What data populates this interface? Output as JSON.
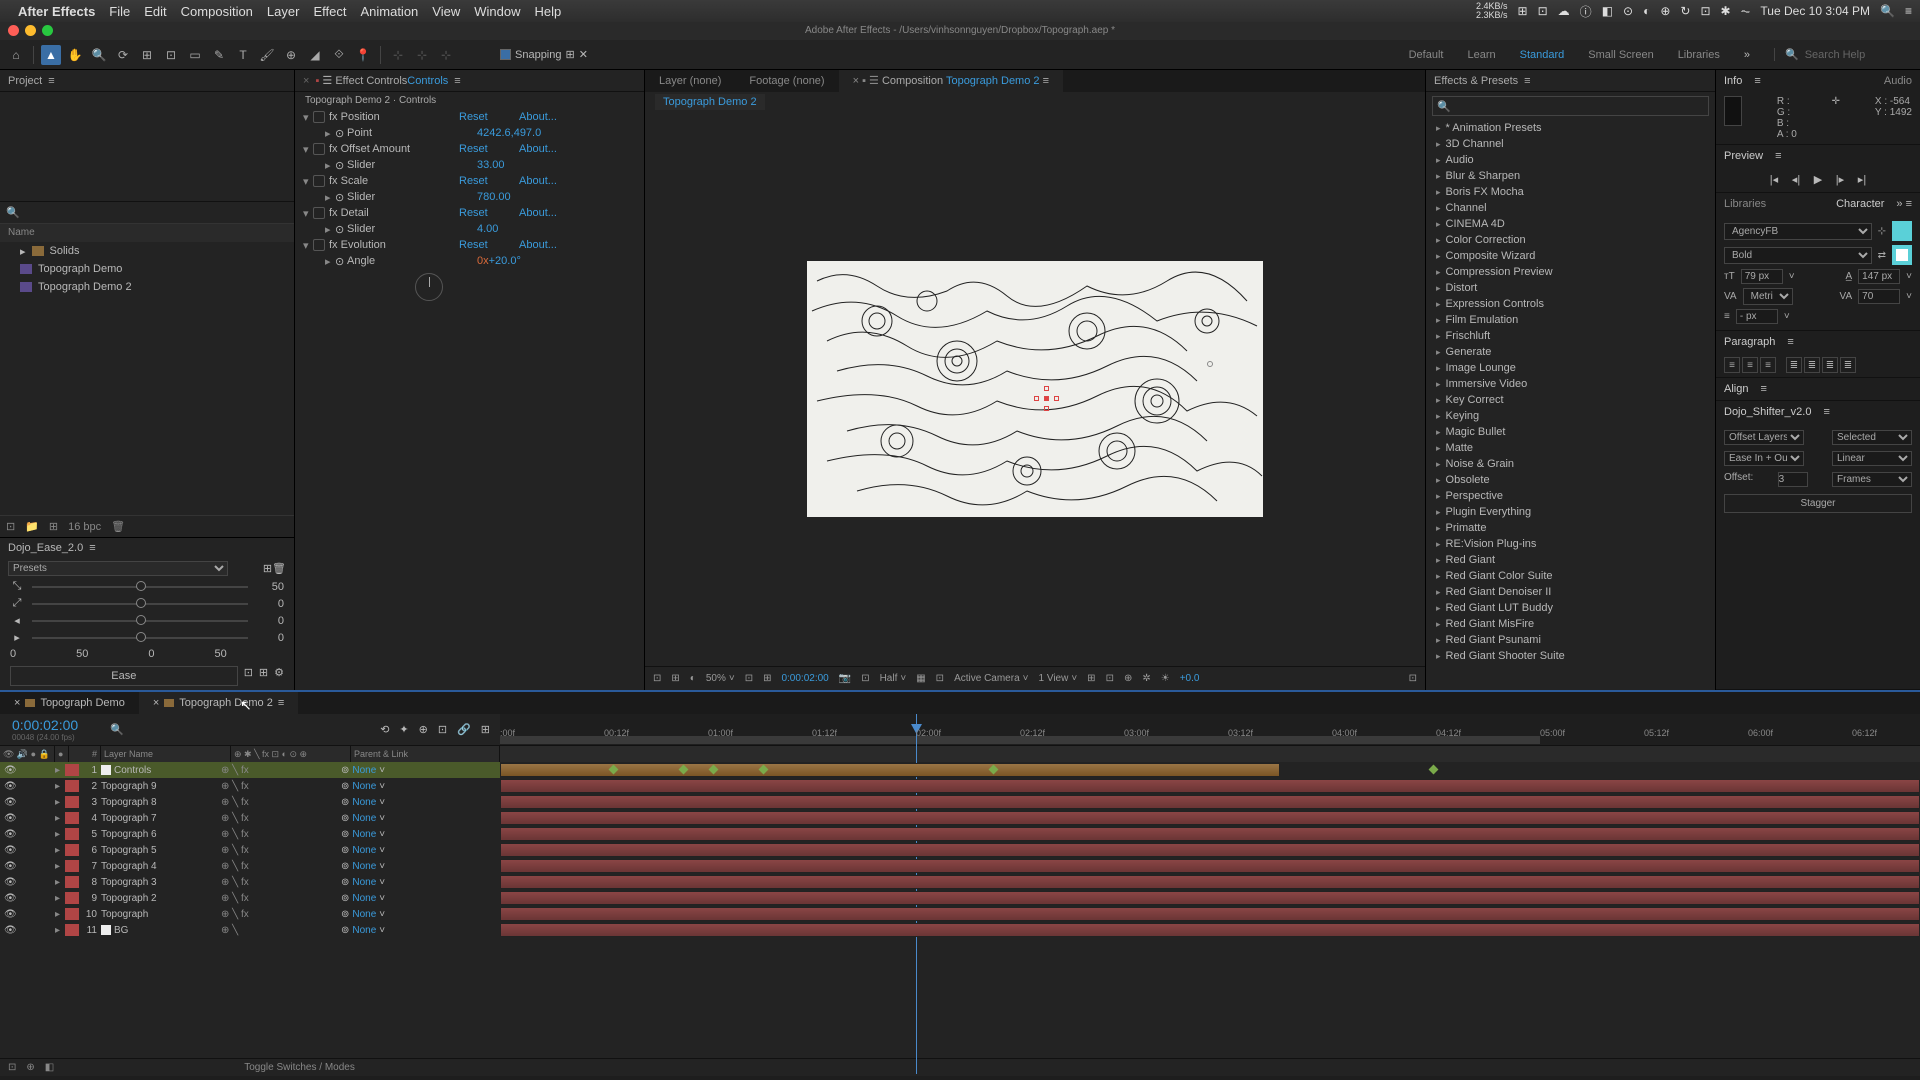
{
  "menubar": {
    "app": "After Effects",
    "items": [
      "File",
      "Edit",
      "Composition",
      "Layer",
      "Effect",
      "Animation",
      "View",
      "Window",
      "Help"
    ],
    "clock": "Tue Dec 10  3:04 PM",
    "net_up": "2.4KB/s",
    "net_dn": "2.3KB/s"
  },
  "doc_title": "Adobe After Effects - /Users/vinhsonnguyen/Dropbox/Topograph.aep *",
  "toolbar": {
    "snapping": "Snapping",
    "workspaces": [
      "Default",
      "Learn",
      "Standard",
      "Small Screen",
      "Libraries"
    ],
    "active_ws": "Standard",
    "search_ph": "Search Help"
  },
  "project": {
    "tab": "Project",
    "name_col": "Name",
    "items": [
      {
        "type": "folder",
        "name": "Solids"
      },
      {
        "type": "comp",
        "name": "Topograph Demo"
      },
      {
        "type": "comp",
        "name": "Topograph Demo 2"
      }
    ],
    "bpc": "16 bpc"
  },
  "effect_controls": {
    "tab_prefix": "Effect Controls ",
    "tab_hl": "Controls",
    "subtitle": "Topograph Demo 2 · Controls",
    "props": [
      {
        "name": "Position",
        "reset": "Reset",
        "about": "About...",
        "sub": {
          "name": "Point",
          "value": "4242.6,497.0"
        }
      },
      {
        "name": "Offset Amount",
        "reset": "Reset",
        "about": "About...",
        "sub": {
          "name": "Slider",
          "value": "33.00"
        }
      },
      {
        "name": "Scale",
        "reset": "Reset",
        "about": "About...",
        "sub": {
          "name": "Slider",
          "value": "780.00"
        }
      },
      {
        "name": "Detail",
        "reset": "Reset",
        "about": "About...",
        "sub": {
          "name": "Slider",
          "value": "4.00"
        }
      },
      {
        "name": "Evolution",
        "reset": "Reset",
        "about": "About...",
        "sub": {
          "name": "Angle",
          "value_dim": "0x",
          "value": "+20.0°"
        }
      }
    ]
  },
  "comp": {
    "tabs": [
      {
        "label": "Layer (none)"
      },
      {
        "label": "Footage (none)"
      },
      {
        "label_pre": "Composition ",
        "label_hl": "Topograph Demo 2",
        "active": true
      }
    ],
    "subtab": "Topograph Demo 2",
    "footer": {
      "zoom": "50%",
      "time": "0:00:02:00",
      "res": "Half",
      "camera": "Active Camera",
      "view": "1 View",
      "exposure": "+0.0"
    }
  },
  "effects_presets": {
    "tab": "Effects & Presets",
    "items": [
      "* Animation Presets",
      "3D Channel",
      "Audio",
      "Blur & Sharpen",
      "Boris FX Mocha",
      "Channel",
      "CINEMA 4D",
      "Color Correction",
      "Composite Wizard",
      "Compression Preview",
      "Distort",
      "Expression Controls",
      "Film Emulation",
      "Frischluft",
      "Generate",
      "Image Lounge",
      "Immersive Video",
      "Key Correct",
      "Keying",
      "Magic Bullet",
      "Matte",
      "Noise & Grain",
      "Obsolete",
      "Perspective",
      "Plugin Everything",
      "Primatte",
      "RE:Vision Plug-ins",
      "Red Giant",
      "Red Giant Color Suite",
      "Red Giant Denoiser II",
      "Red Giant LUT Buddy",
      "Red Giant MisFire",
      "Red Giant Psunami",
      "Red Giant Shooter Suite"
    ]
  },
  "info": {
    "tab1": "Info",
    "tab2": "Audio",
    "r": "R :",
    "g": "G :",
    "b": "B :",
    "a": "A :  0",
    "x": "X :  -564",
    "y": "Y :   1492"
  },
  "preview": {
    "tab": "Preview"
  },
  "char": {
    "tab1": "Libraries",
    "tab2": "Character",
    "font": "AgencyFB",
    "weight": "Bold",
    "size": "79 px",
    "leading": "147 px",
    "kerning": "Metrics",
    "tracking": "70",
    "stroke": "- px"
  },
  "para": {
    "tab": "Paragraph"
  },
  "align": {
    "tab": "Align"
  },
  "shifter": {
    "tab": "Dojo_Shifter_v2.0",
    "offset_lbl": "Offset Layers",
    "sel_lbl": "Selected",
    "ease_lbl": "Ease In + Out",
    "lin_lbl": "Linear",
    "off_lbl": "Offset:",
    "off_val": "3",
    "frames_lbl": "Frames",
    "stagger": "Stagger"
  },
  "dojo": {
    "tab": "Dojo_Ease_2.0",
    "presets": "Presets",
    "vals": [
      "50",
      "0",
      "0",
      "0"
    ],
    "nums": [
      "0",
      "50",
      "0",
      "50"
    ],
    "ease": "Ease"
  },
  "timeline": {
    "tabs": [
      {
        "name": "Topograph Demo"
      },
      {
        "name": "Topograph Demo 2",
        "active": true
      }
    ],
    "timecode": "0:00:02:00",
    "framecode": "00048 (24.00 fps)",
    "col_layer": "Layer Name",
    "col_parent": "Parent & Link",
    "ticks": [
      ":00f",
      "00:12f",
      "01:00f",
      "01:12f",
      "02:00f",
      "02:12f",
      "03:00f",
      "03:12f",
      "04:00f",
      "04:12f",
      "05:00f",
      "05:12f",
      "06:00f",
      "06:12f"
    ],
    "layers": [
      {
        "num": 1,
        "name": "Controls",
        "parent": "None",
        "selected": true,
        "solid": true
      },
      {
        "num": 2,
        "name": "Topograph 9",
        "parent": "None"
      },
      {
        "num": 3,
        "name": "Topograph 8",
        "parent": "None"
      },
      {
        "num": 4,
        "name": "Topograph 7",
        "parent": "None"
      },
      {
        "num": 5,
        "name": "Topograph 6",
        "parent": "None"
      },
      {
        "num": 6,
        "name": "Topograph 5",
        "parent": "None"
      },
      {
        "num": 7,
        "name": "Topograph 4",
        "parent": "None"
      },
      {
        "num": 8,
        "name": "Topograph 3",
        "parent": "None"
      },
      {
        "num": 9,
        "name": "Topograph 2",
        "parent": "None"
      },
      {
        "num": 10,
        "name": "Topograph",
        "parent": "None"
      },
      {
        "num": 11,
        "name": "BG",
        "parent": "None",
        "solid": true,
        "nofx": true
      }
    ],
    "footer": "Toggle Switches / Modes"
  }
}
